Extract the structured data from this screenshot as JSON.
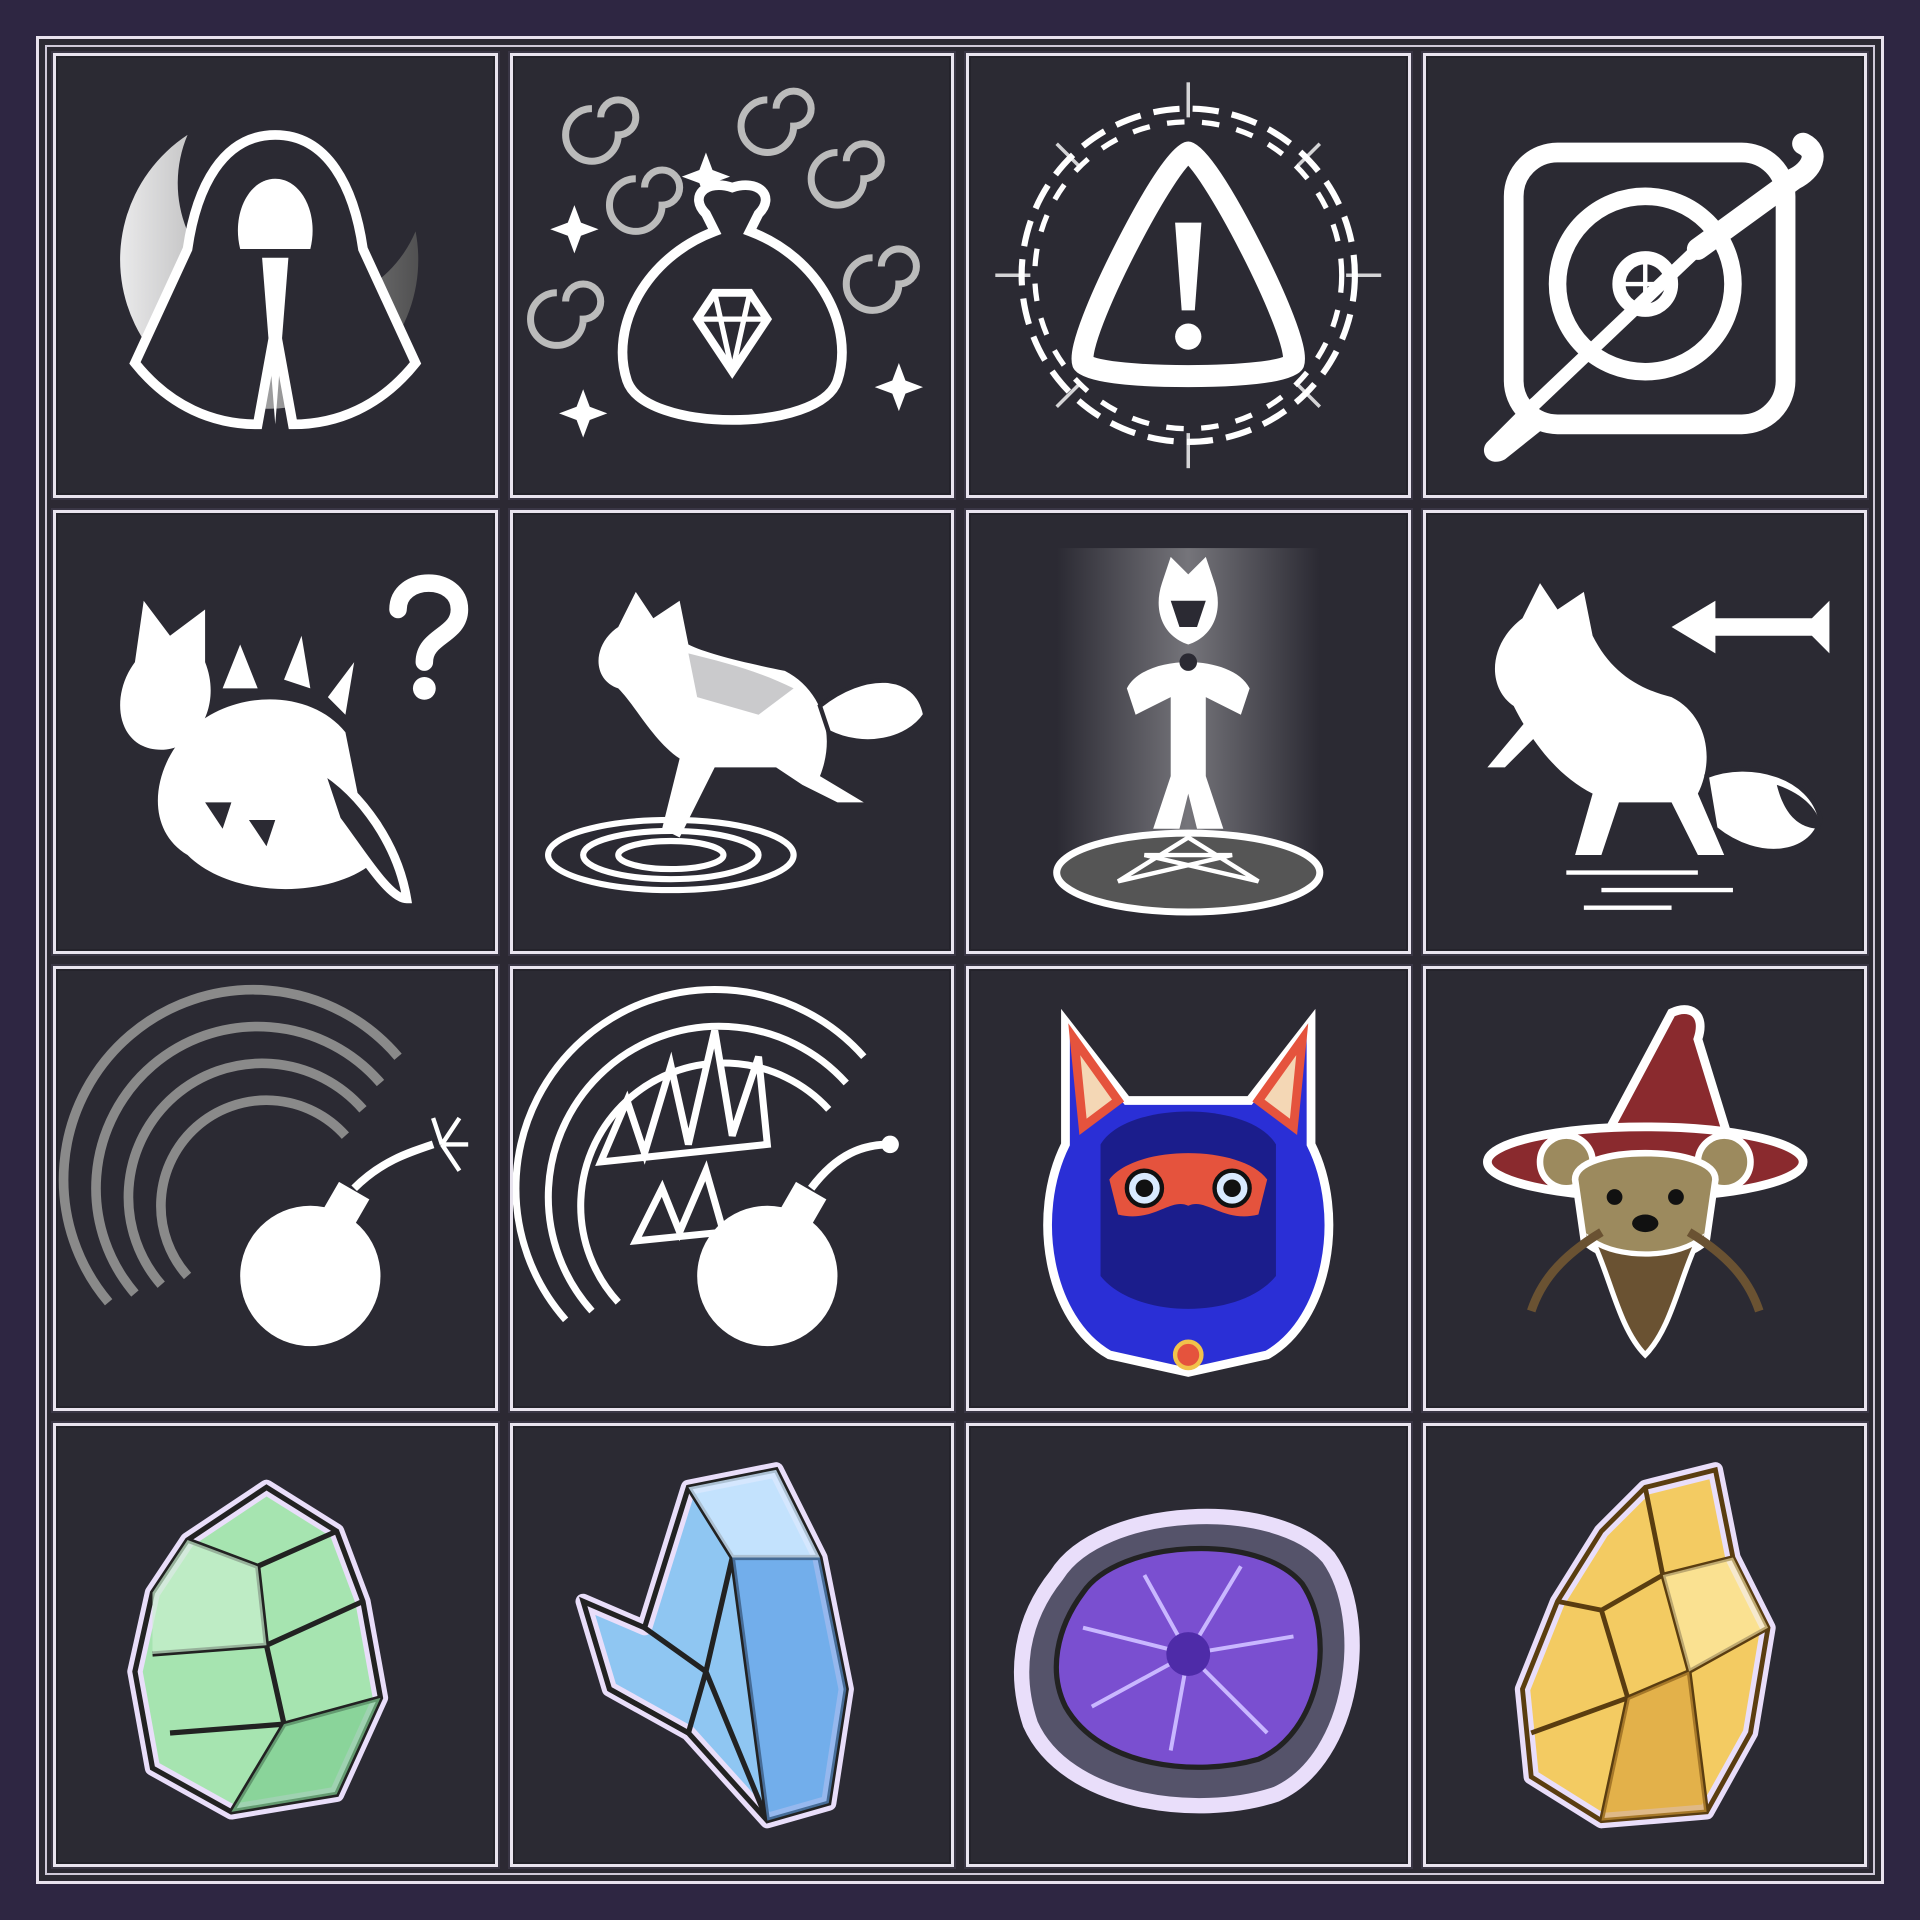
{
  "icons": [
    {
      "name": "hooded-cloak-moon-icon"
    },
    {
      "name": "gem-loot-bag-icon"
    },
    {
      "name": "warning-triangle-icon"
    },
    {
      "name": "screwdriver-disc-icon"
    },
    {
      "name": "confused-fox-monster-icon"
    },
    {
      "name": "fox-ripple-step-icon"
    },
    {
      "name": "fox-pentagram-summon-icon"
    },
    {
      "name": "fox-dash-back-icon"
    },
    {
      "name": "bomb-shockwave-icon"
    },
    {
      "name": "bomb-spikes-icon"
    },
    {
      "name": "hooded-fox-mask-portrait-icon"
    },
    {
      "name": "bear-wizard-portrait-icon"
    },
    {
      "name": "green-crystal-cluster-icon"
    },
    {
      "name": "blue-crystal-cluster-icon"
    },
    {
      "name": "amethyst-geode-icon"
    },
    {
      "name": "gold-crystal-cluster-icon"
    }
  ],
  "colors": {
    "background": "#2e2642",
    "tile": "#2b2a33",
    "line": "#ffffff",
    "hood_blue": "#2a2fd6",
    "mask_red": "#e5533d",
    "wizard_hat": "#8a2a2e",
    "bear_fur": "#9c8a5e",
    "green_crystal": "#a6e4b0",
    "blue_crystal": "#8fc6f2",
    "amethyst": "#7a4fd0",
    "gold_crystal": "#f3cb62"
  }
}
